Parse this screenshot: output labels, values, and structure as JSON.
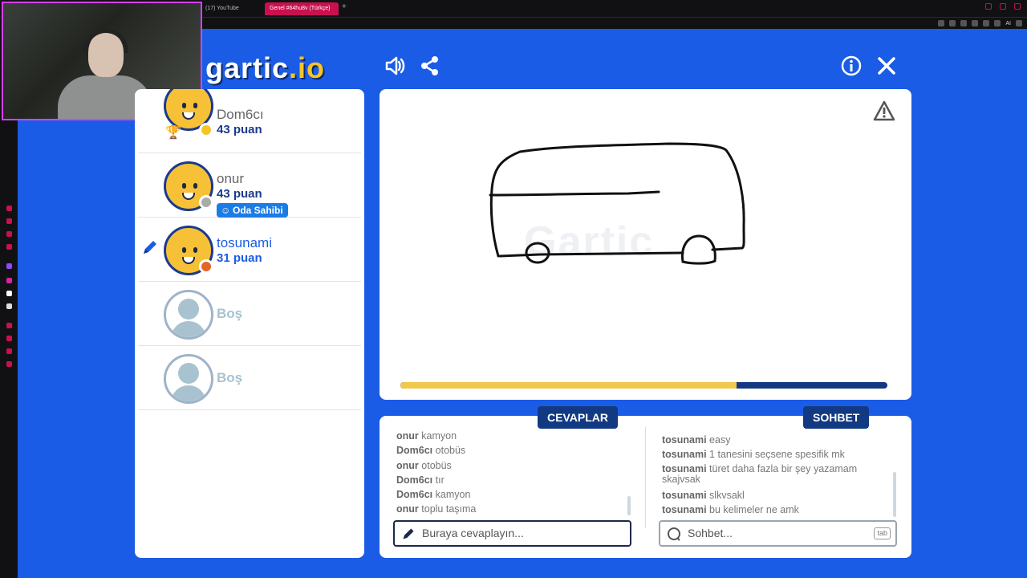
{
  "browser": {
    "tabs": [
      {
        "label": "(17) YouTube",
        "active": false
      },
      {
        "label": "Genel #64hu8v (Türkçe)",
        "active": true
      }
    ],
    "toolbar_badge": "AI",
    "accent": "#c8114e"
  },
  "game": {
    "logo_text": "gartic",
    "logo_suffix": ".io",
    "icons": [
      "sound-icon",
      "share-icon",
      "info-icon",
      "close-icon"
    ],
    "players": [
      {
        "name": "Dom6cı",
        "score": "43 puan",
        "status_color": "#f5c526",
        "trophy": true
      },
      {
        "name": "onur",
        "score": "43 puan",
        "status_color": "#aaaaaa",
        "badge": "Oda Sahibi"
      },
      {
        "name": "tosunami",
        "score": "31 puan",
        "status_color": "#e0662a",
        "drawing": true
      },
      {
        "name": "Boş"
      },
      {
        "name": "Boş"
      }
    ],
    "board": {
      "timer_fraction": 0.69,
      "watermark": "Gartic"
    },
    "answers": {
      "tab_label": "CEVAPLAR",
      "placeholder": "Buraya cevaplayın...",
      "messages": [
        {
          "user": "onur",
          "text": "kamyon"
        },
        {
          "user": "Dom6cı",
          "text": "otobüs"
        },
        {
          "user": "onur",
          "text": "otobüs"
        },
        {
          "user": "Dom6cı",
          "text": "tır"
        },
        {
          "user": "Dom6cı",
          "text": "kamyon"
        },
        {
          "user": "onur",
          "text": "toplu taşıma"
        }
      ]
    },
    "chat": {
      "tab_label": "SOHBET",
      "placeholder": "Sohbet...",
      "key_hint": "tab",
      "messages": [
        {
          "user": "tosunami",
          "text": "easy"
        },
        {
          "user": "tosunami",
          "text": "1 tanesini seçsene spesifik mk"
        },
        {
          "user": "tosunami",
          "text": "türet daha fazla bir şey yazamam skajvsak"
        },
        {
          "user": "tosunami",
          "text": "slkvsakl"
        },
        {
          "user": "tosunami",
          "text": "bu kelimeler ne amk"
        }
      ]
    }
  }
}
